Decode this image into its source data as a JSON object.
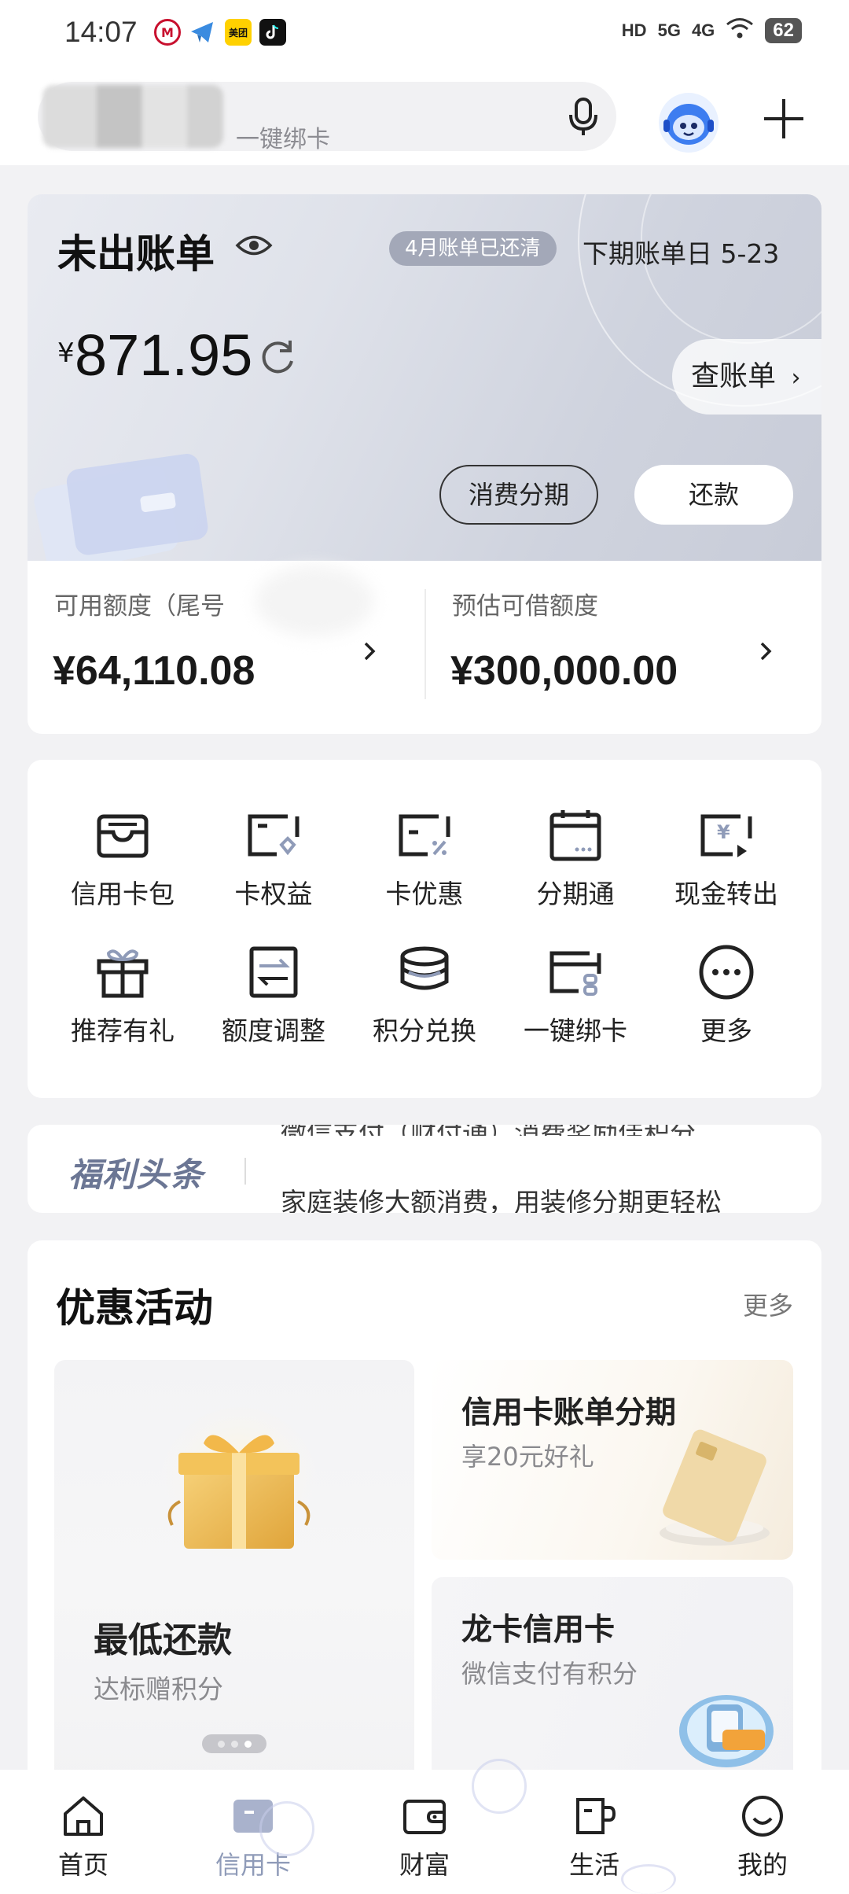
{
  "status_bar": {
    "time": "14:07",
    "network": [
      "HD",
      "5G",
      "4G"
    ],
    "battery": "62",
    "app_icons": [
      "metro-app-icon",
      "telegram-app-icon",
      "meituan-app-icon",
      "tiktok-app-icon"
    ],
    "app_icon_texts": [
      "美团"
    ]
  },
  "search": {
    "placeholder": "一键绑卡"
  },
  "bill": {
    "title": "未出账单",
    "badge": "4月账单已还清",
    "next_bill_date": "下期账单日 5-23",
    "currency": "¥",
    "amount": "871.95",
    "view_bill": "查账单",
    "installment_button": "消费分期",
    "repay_button": "还款"
  },
  "credit": {
    "available_label": "可用额度（尾号",
    "available_value": "¥64,110.08",
    "estimated_label": "预估可借额度",
    "estimated_value": "¥300,000.00"
  },
  "menu": {
    "items": [
      {
        "label": "信用卡包",
        "icon": "card-wallet-icon"
      },
      {
        "label": "卡权益",
        "icon": "card-benefit-icon"
      },
      {
        "label": "卡优惠",
        "icon": "card-discount-icon"
      },
      {
        "label": "分期通",
        "icon": "calendar-installment-icon"
      },
      {
        "label": "现金转出",
        "icon": "cash-transfer-icon"
      },
      {
        "label": "推荐有礼",
        "icon": "gift-icon"
      },
      {
        "label": "额度调整",
        "icon": "limit-adjust-icon"
      },
      {
        "label": "积分兑换",
        "icon": "points-stack-icon"
      },
      {
        "label": "一键绑卡",
        "icon": "bind-card-icon"
      },
      {
        "label": "更多",
        "icon": "more-dots-icon"
      }
    ]
  },
  "news": {
    "brand": "福利头条",
    "headline_prev": "微信支付（财付通）消费奖励佳积分",
    "headline": "家庭装修大额消费，用装修分期更轻松"
  },
  "promotions": {
    "title": "优惠活动",
    "more": "更多",
    "cards": [
      {
        "title": "最低还款",
        "subtitle": "达标赠积分"
      },
      {
        "title": "信用卡账单分期",
        "subtitle": "享20元好礼"
      },
      {
        "title": "龙卡信用卡",
        "subtitle": "微信支付有积分"
      }
    ],
    "carousel": {
      "count": 3,
      "active": 3
    }
  },
  "tabbar": {
    "items": [
      {
        "label": "首页",
        "icon": "home-icon"
      },
      {
        "label": "信用卡",
        "icon": "credit-card-icon"
      },
      {
        "label": "财富",
        "icon": "wallet-icon"
      },
      {
        "label": "生活",
        "icon": "cup-icon"
      },
      {
        "label": "我的",
        "icon": "smile-icon"
      }
    ],
    "active": "信用卡"
  },
  "colors": {
    "active_tab": "#8f9bb8",
    "badge_bg": "#a3a8b8",
    "brand_text": "#6b7694"
  }
}
